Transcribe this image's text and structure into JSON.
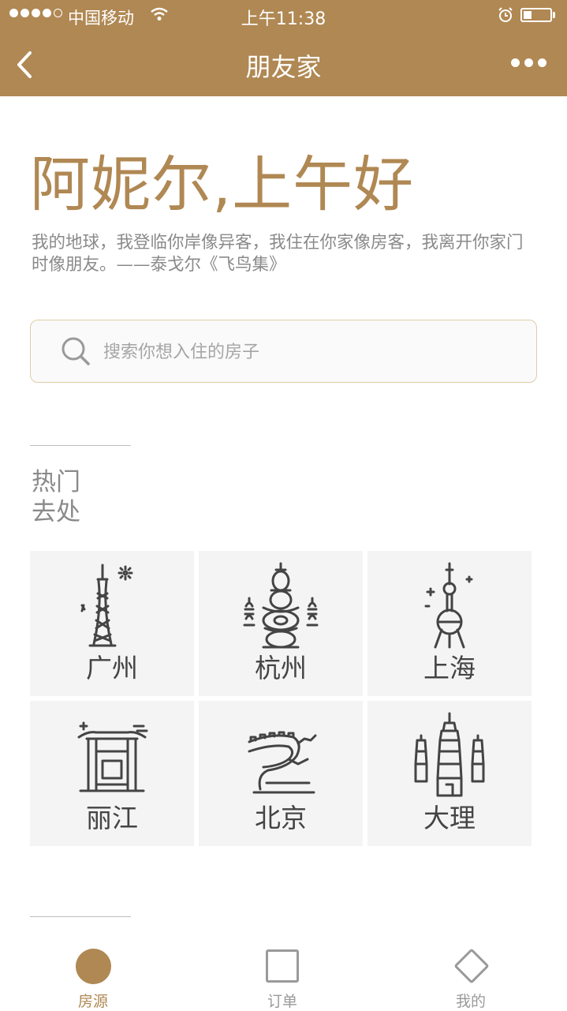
{
  "status_bar": {
    "carrier": "中国移动",
    "time": "上午11:38",
    "battery_level": 0.3
  },
  "nav": {
    "title": "朋友家"
  },
  "greeting": "阿妮尔,上午好",
  "quote": "我的地球，我登临你岸像异客，我住在你家像房客，我离开你家门时像朋友。——泰戈尔《飞鸟集》",
  "search": {
    "placeholder": "搜索你想入住的房子",
    "value": ""
  },
  "section": {
    "title_line1": "热门",
    "title_line2": "去处"
  },
  "cities": [
    {
      "name": "广州",
      "icon": "canton-tower-icon"
    },
    {
      "name": "杭州",
      "icon": "pagoda-icon"
    },
    {
      "name": "上海",
      "icon": "oriental-pearl-tower-icon"
    },
    {
      "name": "丽江",
      "icon": "gate-icon"
    },
    {
      "name": "北京",
      "icon": "great-wall-icon"
    },
    {
      "name": "大理",
      "icon": "three-pagodas-icon"
    }
  ],
  "tabs": [
    {
      "label": "房源",
      "icon": "circle-icon",
      "active": true
    },
    {
      "label": "订单",
      "icon": "square-icon",
      "active": false
    },
    {
      "label": "我的",
      "icon": "diamond-icon",
      "active": false
    }
  ],
  "colors": {
    "brand": "#b08853",
    "border": "#e0cda8",
    "tile_bg": "#f4f4f4"
  }
}
